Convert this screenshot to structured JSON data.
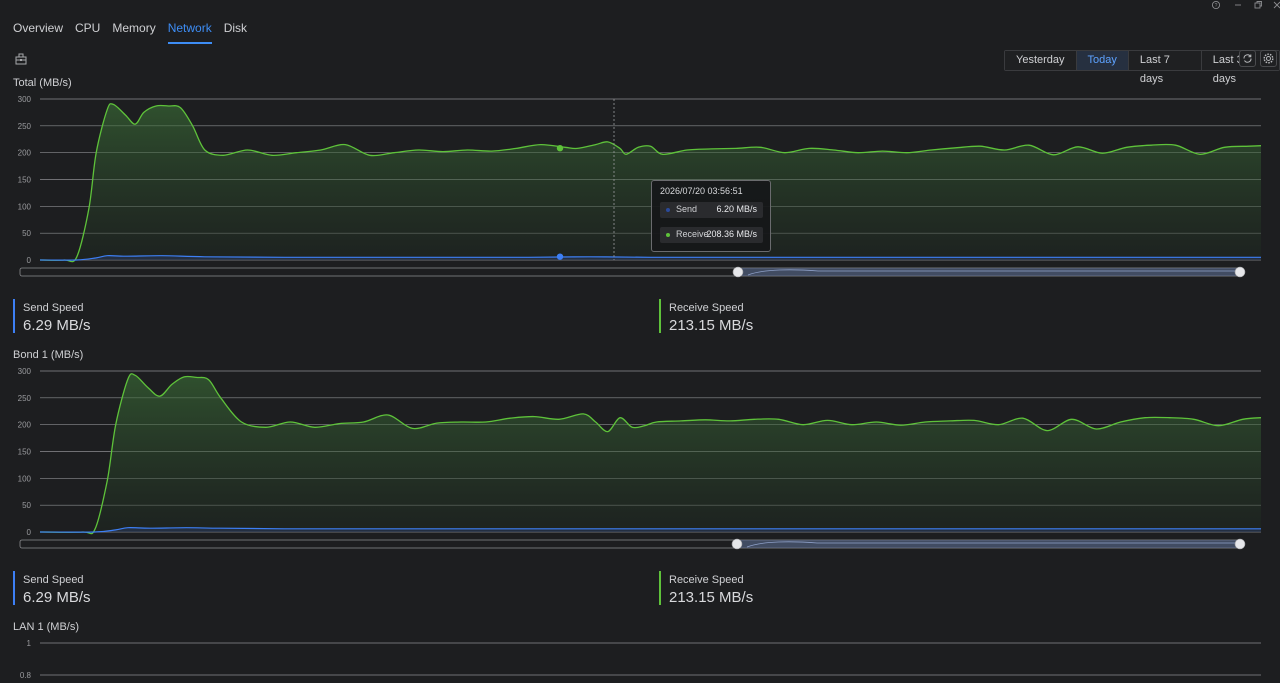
{
  "window": {
    "help_icon": "help-icon",
    "minimize_icon": "minimize-icon",
    "restore_icon": "restore-icon",
    "close_icon": "close-icon"
  },
  "tabs": [
    {
      "label": "Overview",
      "active": false
    },
    {
      "label": "CPU",
      "active": false
    },
    {
      "label": "Memory",
      "active": false
    },
    {
      "label": "Network",
      "active": true
    },
    {
      "label": "Disk",
      "active": false
    }
  ],
  "toolbar": {
    "export_icon": "export-icon",
    "ranges": [
      {
        "label": "Yesterday",
        "active": false
      },
      {
        "label": "Today",
        "active": true
      },
      {
        "label": "Last 7 days",
        "active": false
      },
      {
        "label": "Last 30 days",
        "active": false
      }
    ],
    "refresh_icon": "refresh-icon",
    "settings_icon": "settings-icon"
  },
  "colors": {
    "send": "#3d7ff5",
    "receive": "#5ec23a",
    "accent": "#3d8df5"
  },
  "sections": [
    {
      "title": "Total (MB/s)",
      "send_label": "Send Speed",
      "send_value": "6.29 MB/s",
      "receive_label": "Receive Speed",
      "receive_value": "213.15 MB/s"
    },
    {
      "title": "Bond 1 (MB/s)",
      "send_label": "Send Speed",
      "send_value": "6.29 MB/s",
      "receive_label": "Receive Speed",
      "receive_value": "213.15 MB/s"
    },
    {
      "title": "LAN 1 (MB/s)"
    }
  ],
  "tooltip": {
    "time": "2026/07/20 03:56:51",
    "send_name": "Send",
    "send_value": "6.20 MB/s",
    "receive_name": "Receive",
    "receive_value": "208.36 MB/s"
  },
  "chart_data": [
    {
      "type": "area",
      "title": "Total (MB/s)",
      "yticks": [
        "300",
        "250",
        "200",
        "150",
        "100",
        "50",
        "0"
      ],
      "ylim": [
        0,
        300
      ],
      "grid": true,
      "xlim": [
        0,
        100
      ],
      "series": [
        {
          "name": "Receive",
          "x": [
            0,
            2,
            3,
            4,
            4.6,
            5.5,
            6,
            7,
            7.8,
            8.5,
            9.5,
            10.5,
            11.5,
            12.5,
            13.5,
            15,
            17,
            19,
            21,
            23,
            25,
            27,
            29,
            31,
            33,
            35,
            37,
            39,
            41,
            43,
            44,
            45.5,
            46.5,
            47.5,
            48,
            49,
            50,
            51,
            53,
            55,
            57,
            59,
            61,
            63,
            65,
            67,
            69,
            71,
            73,
            75,
            77,
            79,
            81,
            83,
            85,
            87,
            89,
            91,
            93,
            95,
            97,
            99,
            100
          ],
          "y": [
            0,
            0,
            5,
            95,
            200,
            280,
            290,
            270,
            253,
            275,
            287,
            287,
            284,
            250,
            205,
            195,
            205,
            195,
            200,
            205,
            215,
            195,
            200,
            205,
            202,
            205,
            203,
            208,
            215,
            210,
            208,
            215,
            220,
            208,
            197,
            210,
            212,
            197,
            205,
            207,
            208,
            210,
            200,
            208,
            205,
            200,
            203,
            200,
            205,
            209,
            212,
            205,
            214,
            196,
            211,
            199,
            210,
            214,
            214,
            197,
            210,
            212,
            213
          ]
        },
        {
          "name": "Send",
          "x": [
            0,
            3,
            4.6,
            5.5,
            7,
            10,
            13.5,
            20,
            30,
            40,
            45,
            50,
            60,
            70,
            80,
            90,
            100
          ],
          "y": [
            0,
            0,
            4,
            8,
            7,
            8,
            6,
            5,
            5,
            5,
            6,
            5,
            5,
            5,
            5,
            5,
            5
          ]
        }
      ]
    },
    {
      "type": "area",
      "title": "Bond 1 (MB/s)",
      "yticks": [
        "300",
        "250",
        "200",
        "150",
        "100",
        "50",
        "0"
      ],
      "ylim": [
        0,
        300
      ],
      "grid": true,
      "xlim": [
        0,
        100
      ],
      "series": [
        {
          "name": "Receive",
          "x": [
            0,
            3.5,
            4.5,
            5.5,
            6.2,
            7.2,
            7.8,
            8.8,
            9.8,
            10.8,
            11.8,
            12.8,
            13.8,
            14.8,
            16.5,
            18.5,
            20.5,
            22.5,
            24.5,
            26.5,
            28.5,
            30.5,
            32.5,
            34.5,
            36.5,
            38.5,
            40.5,
            42.5,
            44.5,
            45.5,
            46.5,
            47.5,
            48.5,
            49.5,
            50.5,
            52.5,
            54.5,
            56.5,
            58.5,
            60.5,
            62.5,
            64.5,
            66.5,
            68.5,
            70.5,
            72.5,
            74.5,
            76.5,
            78.5,
            80.5,
            82.5,
            84.5,
            86.5,
            88.5,
            90.5,
            92.5,
            94.5,
            96.5,
            98.5,
            100
          ],
          "y": [
            0,
            0,
            5,
            95,
            200,
            285,
            292,
            270,
            253,
            275,
            289,
            288,
            284,
            250,
            205,
            195,
            205,
            195,
            202,
            205,
            218,
            193,
            203,
            205,
            205,
            212,
            215,
            210,
            220,
            205,
            187,
            213,
            195,
            198,
            205,
            207,
            209,
            207,
            210,
            210,
            200,
            208,
            200,
            205,
            199,
            205,
            207,
            208,
            200,
            212,
            189,
            210,
            192,
            205,
            213,
            213,
            210,
            198,
            210,
            213
          ]
        },
        {
          "name": "Send",
          "x": [
            0,
            4.5,
            6.2,
            7.2,
            9,
            12,
            14.8,
            20,
            30,
            40,
            50,
            60,
            70,
            80,
            90,
            100
          ],
          "y": [
            0,
            0,
            4,
            8,
            7,
            8,
            7,
            6,
            6,
            6,
            6,
            6,
            6,
            6,
            6,
            6
          ]
        }
      ]
    },
    {
      "type": "area",
      "title": "LAN 1 (MB/s)",
      "yticks": [
        "1",
        "0.8"
      ],
      "grid": true
    }
  ]
}
